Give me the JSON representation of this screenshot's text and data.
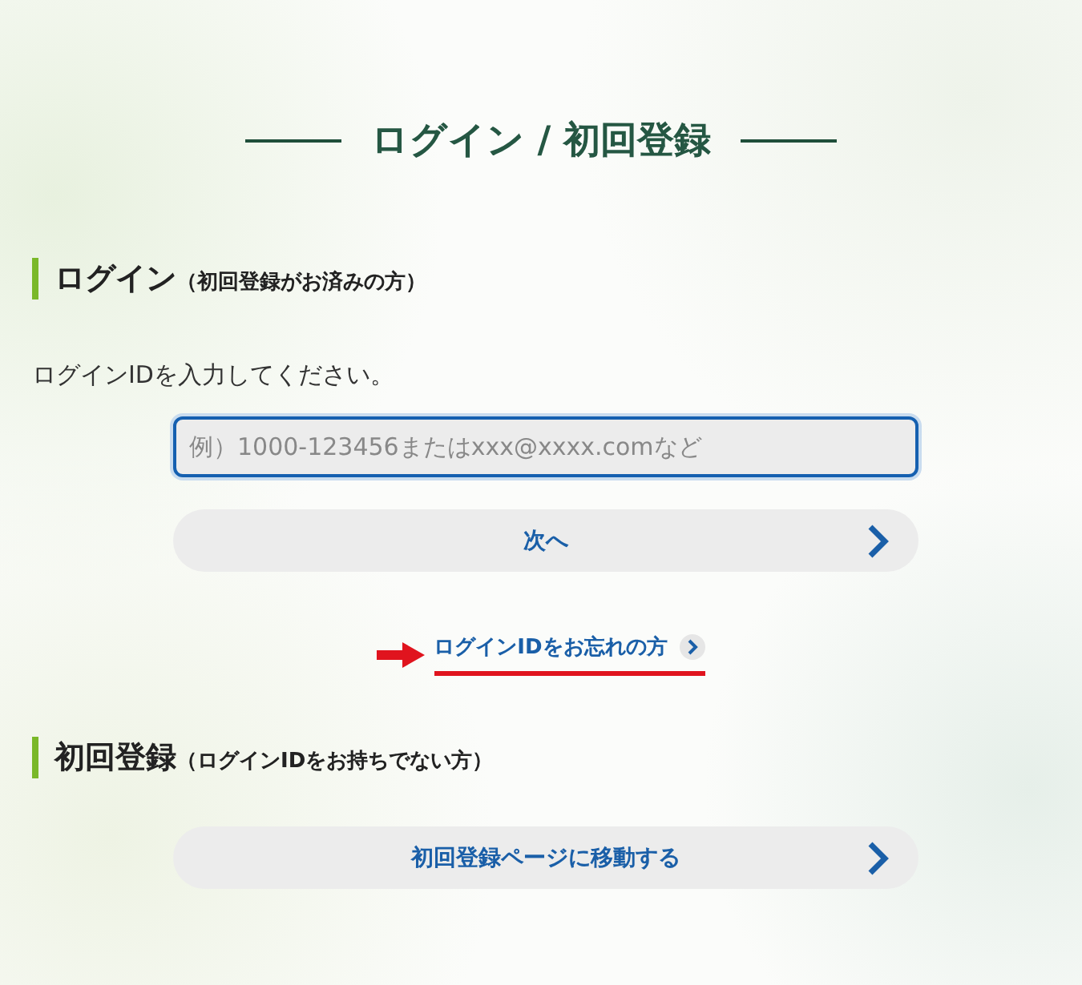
{
  "page_title": "ログイン / 初回登録",
  "login_section": {
    "heading": "ログイン",
    "note": "（初回登録がお済みの方）",
    "instruction": "ログインIDを入力してください。",
    "input": {
      "placeholder": "例）1000-123456またはxxx@xxxx.comなど",
      "focused": true
    },
    "next_button": "次へ",
    "forgot_link": {
      "label": "ログインIDをお忘れの方",
      "highlighted": true
    }
  },
  "register_section": {
    "heading": "初回登録",
    "note": "（ログインIDをお持ちでない方）",
    "button": "初回登録ページに移動する"
  }
}
